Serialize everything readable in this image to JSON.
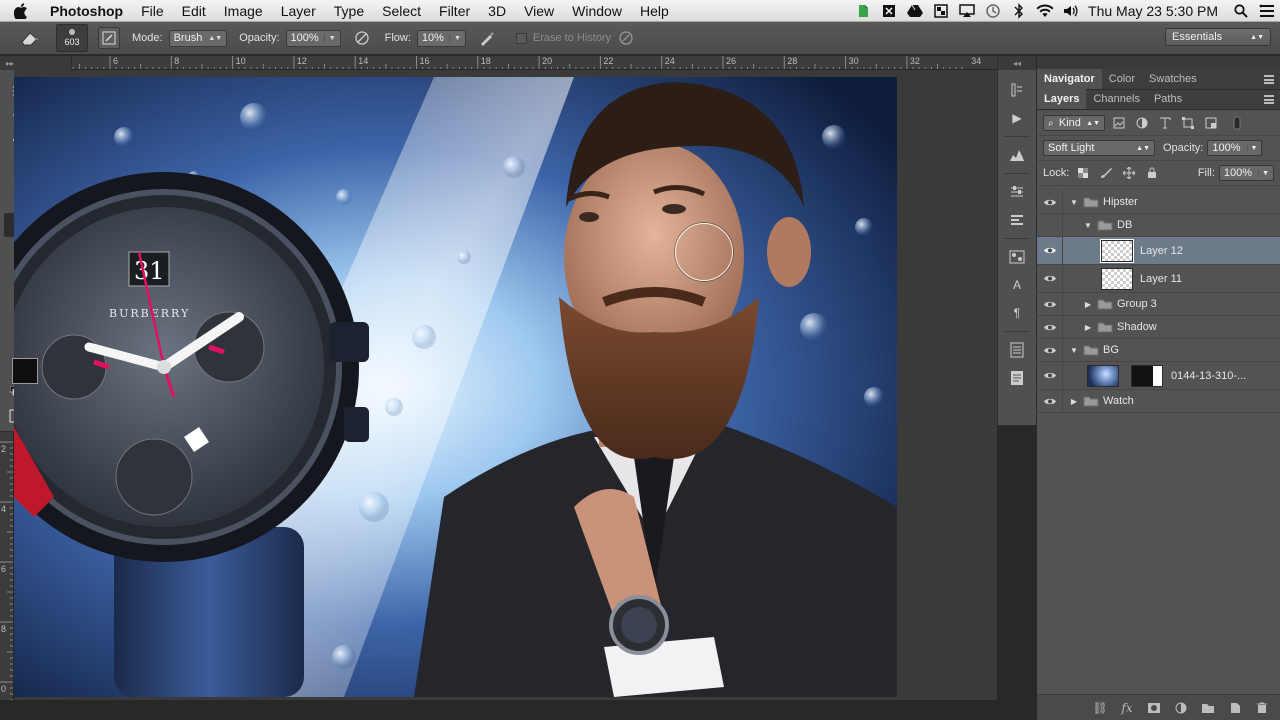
{
  "menubar": {
    "app": "Photoshop",
    "items": [
      "File",
      "Edit",
      "Image",
      "Layer",
      "Type",
      "Select",
      "Filter",
      "3D",
      "View",
      "Window",
      "Help"
    ],
    "clock": "Thu May 23  5:30 PM"
  },
  "options": {
    "brush_size": "603",
    "mode_label": "Mode:",
    "mode_value": "Brush",
    "opacity_label": "Opacity:",
    "opacity_value": "100%",
    "flow_label": "Flow:",
    "flow_value": "10%",
    "erase_history_label": "Erase to History",
    "workspace": "Essentials"
  },
  "ruler": {
    "h_ticks": [
      "6",
      "8",
      "10",
      "12",
      "14",
      "16",
      "18",
      "20",
      "22",
      "24",
      "26",
      "28",
      "30",
      "32",
      "34"
    ],
    "v_ticks": [
      "2",
      "4",
      "6",
      "8",
      "0"
    ]
  },
  "panels": {
    "top_tabs": [
      "Navigator",
      "Color",
      "Swatches"
    ],
    "layer_tabs": [
      "Layers",
      "Channels",
      "Paths"
    ],
    "kind_label": "Kind",
    "blend_mode": "Soft Light",
    "opacity_label": "Opacity:",
    "opacity_value": "100%",
    "lock_label": "Lock:",
    "fill_label": "Fill:",
    "fill_value": "100%"
  },
  "layers": [
    {
      "name": "Hipster"
    },
    {
      "name": "DB"
    },
    {
      "name": "Layer 12"
    },
    {
      "name": "Layer 11"
    },
    {
      "name": "Group 3"
    },
    {
      "name": "Shadow"
    },
    {
      "name": "BG"
    },
    {
      "name": "0144-13-310-..."
    },
    {
      "name": "Watch"
    }
  ],
  "colors": {
    "foreground": "#0f0f0f",
    "background": "#f4f4f4",
    "selection": "#6d7a89"
  }
}
